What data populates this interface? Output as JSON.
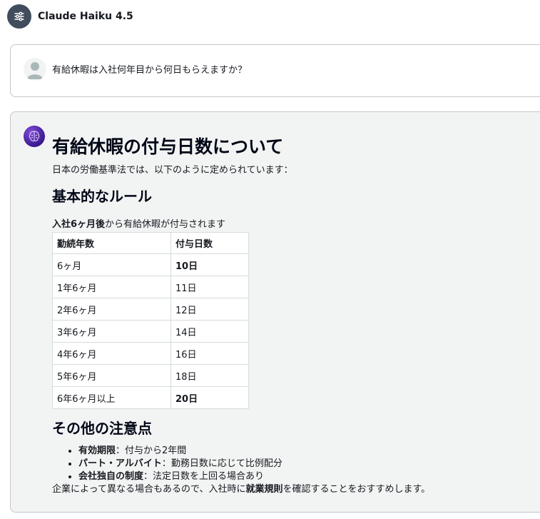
{
  "header": {
    "model_name": "Claude Haiku 4.5",
    "icon": "sliders-icon"
  },
  "user_message": {
    "text": "有給休暇は入社何年目から何日もらえますか？",
    "avatar": "user-avatar-icon"
  },
  "assistant_message": {
    "avatar": "brain-icon",
    "title": "有給休暇の付与日数について",
    "intro": "日本の労働基準法では、以下のように定められています：",
    "section1_heading": "基本的なルール",
    "rule_bold": "入社6ヶ月後",
    "rule_rest": "から有給休暇が付与されます",
    "table": {
      "headers": [
        "勤続年数",
        "付与日数"
      ],
      "rows": [
        {
          "years": "6ヶ月",
          "days": "10日",
          "bold": true
        },
        {
          "years": "1年6ヶ月",
          "days": "11日",
          "bold": false
        },
        {
          "years": "2年6ヶ月",
          "days": "12日",
          "bold": false
        },
        {
          "years": "3年6ヶ月",
          "days": "14日",
          "bold": false
        },
        {
          "years": "4年6ヶ月",
          "days": "16日",
          "bold": false
        },
        {
          "years": "5年6ヶ月",
          "days": "18日",
          "bold": false
        },
        {
          "years": "6年6ヶ月以上",
          "days": "20日",
          "bold": true
        }
      ]
    },
    "section2_heading": "その他の注意点",
    "notes": [
      {
        "label": "有効期限",
        "text": "：付与から2年間"
      },
      {
        "label": "パート・アルバイト",
        "text": "：勤務日数に応じて比例配分"
      },
      {
        "label": "会社独自の制度",
        "text": "：法定日数を上回る場合あり"
      }
    ],
    "closing_before": "企業によって異なる場合もあるので、入社時に",
    "closing_bold": "就業規則",
    "closing_after": "を確認することをおすすめします。"
  }
}
